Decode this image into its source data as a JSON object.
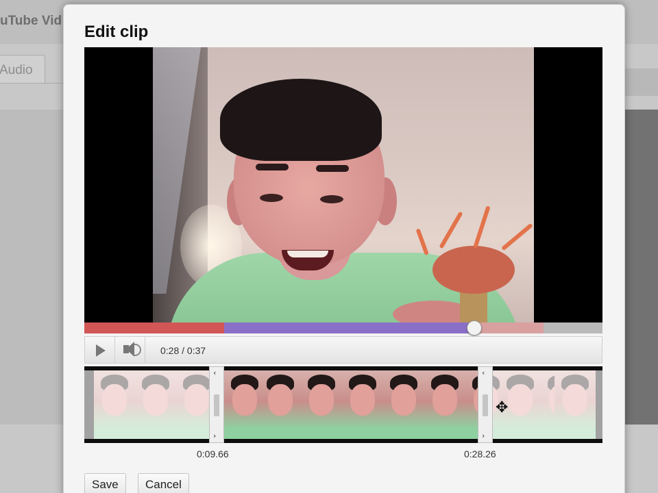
{
  "background": {
    "app_title": "uTube Vid",
    "tab_label": "Audio"
  },
  "dialog": {
    "title": "Edit clip"
  },
  "player": {
    "time_display": "0:28 / 0:37",
    "progress_fraction": 0.757
  },
  "filmstrip": {
    "start_time": "0:09.66",
    "end_time": "0:28.26",
    "left_handle_arrows": [
      "‹",
      "›"
    ],
    "right_handle_arrows": [
      "‹",
      "›"
    ]
  },
  "buttons": {
    "save_label": "Save",
    "cancel_label": "Cancel"
  },
  "icons": {
    "play": "play-icon",
    "volume": "volume-icon",
    "move": "move-cursor-icon"
  },
  "colors": {
    "progress_played": "#d35656",
    "progress_clip": "#8a6fc8",
    "progress_buffered": "#d9a0a0"
  }
}
